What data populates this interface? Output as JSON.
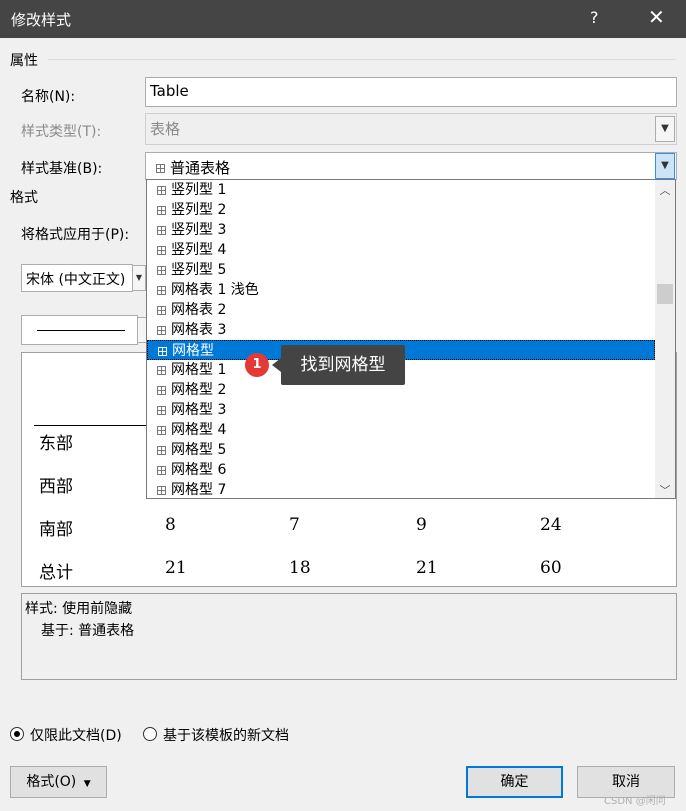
{
  "window": {
    "title": "修改样式",
    "help": "?",
    "close": "✕"
  },
  "properties": {
    "section": "属性",
    "name_label": "名称(N):",
    "name_value": "Table",
    "type_label": "样式类型(T):",
    "type_value": "表格",
    "base_label": "样式基准(B):",
    "base_value": "普通表格"
  },
  "format": {
    "section": "格式",
    "apply_label": "将格式应用于(P):",
    "font_value": "宋体 (中文正文)"
  },
  "dropdown_items": [
    "竖列型 1",
    "竖列型 2",
    "竖列型 3",
    "竖列型 4",
    "竖列型 5",
    "网格表 1 浅色",
    "网格表 2",
    "网格表 3",
    "网格型",
    "网格型 1",
    "网格型 2",
    "网格型 3",
    "网格型 4",
    "网格型 5",
    "网格型 6",
    "网格型 7"
  ],
  "selected_item": "网格型",
  "annotation": {
    "badge": "1",
    "tip": "找到网格型"
  },
  "preview": {
    "rows": [
      {
        "label": "东部",
        "values": []
      },
      {
        "label": "西部",
        "values": []
      },
      {
        "label": "南部",
        "values": [
          "8",
          "7",
          "9",
          "24"
        ]
      },
      {
        "label": "总计",
        "values": [
          "21",
          "18",
          "21",
          "60"
        ]
      }
    ]
  },
  "description": {
    "line1": "样式: 使用前隐藏",
    "line2": "基于: 普通表格"
  },
  "options": {
    "only_this_doc": "仅限此文档(D)",
    "new_docs": "基于该模板的新文档"
  },
  "buttons": {
    "format": "格式(O)",
    "ok": "确定",
    "cancel": "取消"
  },
  "watermark": "CSDN @闲问"
}
